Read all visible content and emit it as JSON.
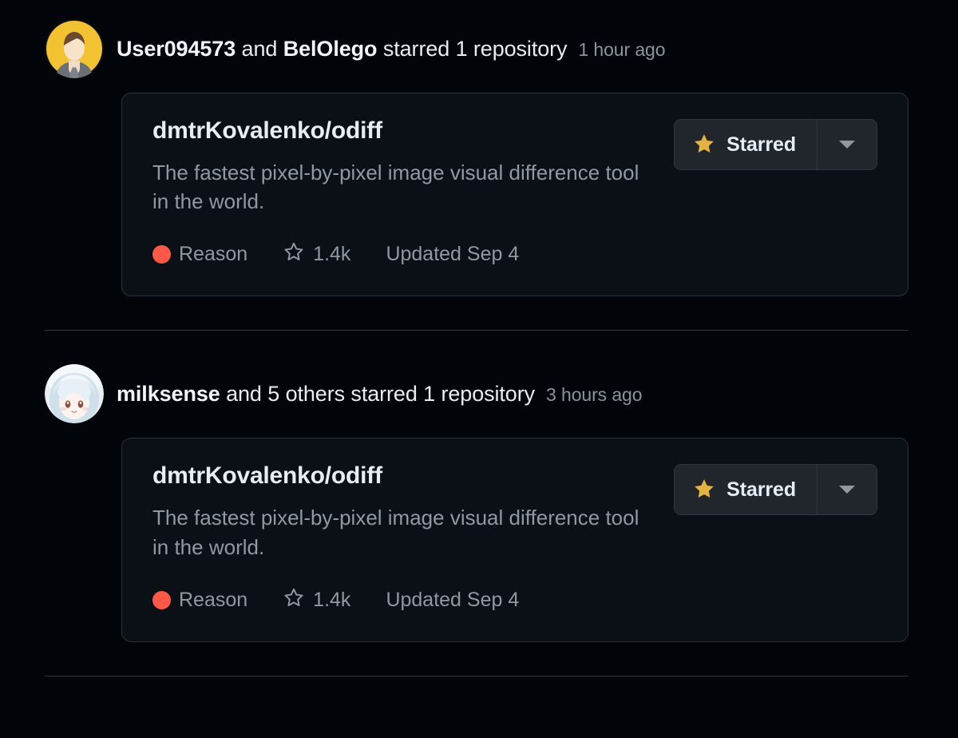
{
  "theme": {
    "page_bg": "#010409",
    "card_bg": "#0b1016",
    "card_border": "#2b313a",
    "button_bg": "#21262d",
    "text_primary": "#e6edf3",
    "text_muted": "#9198a1",
    "star_gold": "#e3b341",
    "language_color": "#ff5847",
    "divider": "#30363d"
  },
  "feed": {
    "items": [
      {
        "avatar_name": "avatar-user094573",
        "header": {
          "actor_primary": "User094573",
          "connector": " and ",
          "actor_secondary": "BelOlego",
          "action": " starred 1 repository",
          "timestamp": "1 hour ago"
        },
        "repo": {
          "name": "dmtrKovalenko/odiff",
          "description": "The fastest pixel-by-pixel image visual difference tool in the world.",
          "language": "Reason",
          "language_color": "#ff5847",
          "stars": "1.4k",
          "updated": "Updated Sep 4",
          "star_button_label": "Starred",
          "star_icon": "star-filled-icon",
          "caret_icon": "chevron-down-icon",
          "stars_icon": "star-outline-icon"
        }
      },
      {
        "avatar_name": "avatar-milksense",
        "header": {
          "actor_primary": "milksense",
          "connector": " and ",
          "actor_secondary": "5 others",
          "action": " starred 1 repository",
          "timestamp": "3 hours ago"
        },
        "repo": {
          "name": "dmtrKovalenko/odiff",
          "description": "The fastest pixel-by-pixel image visual difference tool in the world.",
          "language": "Reason",
          "language_color": "#ff5847",
          "stars": "1.4k",
          "updated": "Updated Sep 4",
          "star_button_label": "Starred",
          "star_icon": "star-filled-icon",
          "caret_icon": "chevron-down-icon",
          "stars_icon": "star-outline-icon"
        }
      }
    ]
  }
}
